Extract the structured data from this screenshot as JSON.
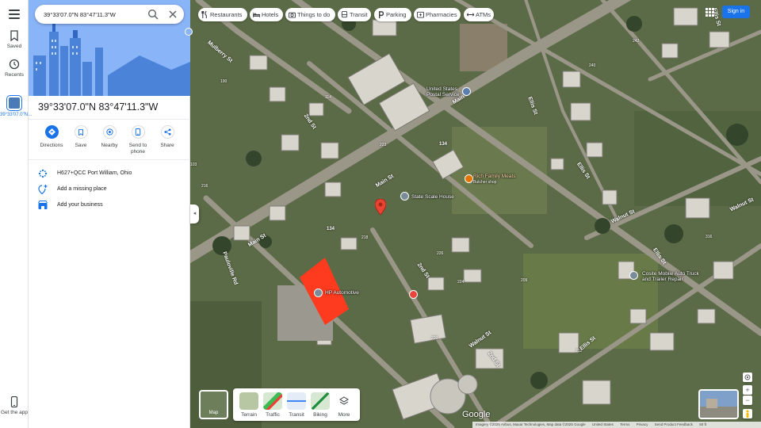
{
  "search": {
    "value": "39°33'07.0\"N 83°47'11.3\"W"
  },
  "rail": {
    "saved_label": "Saved",
    "recents_label": "Recents",
    "recent_place_label": "39°33'07.0\"N...",
    "get_app_label": "Get the app"
  },
  "place": {
    "title": "39°33'07.0\"N 83°47'11.3\"W",
    "actions": [
      {
        "label": "Directions",
        "icon": "directions-icon"
      },
      {
        "label": "Save",
        "icon": "bookmark-icon"
      },
      {
        "label": "Nearby",
        "icon": "nearby-icon"
      },
      {
        "label": "Send to phone",
        "icon": "phone-icon"
      },
      {
        "label": "Share",
        "icon": "share-icon"
      }
    ],
    "details": [
      {
        "text": "H627+QCC Port William, Ohio",
        "icon": "plus-code-icon"
      },
      {
        "text": "Add a missing place",
        "icon": "add-place-icon"
      },
      {
        "text": "Add your business",
        "icon": "business-icon"
      }
    ]
  },
  "chips": [
    {
      "label": "Restaurants",
      "icon": "restaurant-icon"
    },
    {
      "label": "Hotels",
      "icon": "hotel-icon"
    },
    {
      "label": "Things to do",
      "icon": "camera-icon"
    },
    {
      "label": "Transit",
      "icon": "transit-icon"
    },
    {
      "label": "Parking",
      "icon": "parking-icon"
    },
    {
      "label": "Pharmacies",
      "icon": "pharmacy-icon"
    },
    {
      "label": "ATMs",
      "icon": "atm-icon"
    }
  ],
  "header": {
    "signin_label": "Sign in"
  },
  "map": {
    "places": [
      {
        "name": "United States Postal Service"
      },
      {
        "name": "Rich Family Meats",
        "sub": "Butcher shop"
      },
      {
        "name": "State Scale House"
      },
      {
        "name": "HP Automotive"
      },
      {
        "name": "Cosite Mobile Auto Truck and Trailer Repair"
      }
    ],
    "roads": [
      "Mulberry St",
      "Main St",
      "2nd St",
      "Ellis St",
      "Walnut St",
      "Pauloville Rd",
      "134"
    ],
    "house_numbers": [
      "242",
      "240",
      "114",
      "223",
      "103",
      "218",
      "226",
      "224",
      "209",
      "220",
      "212",
      "316",
      "190",
      "216"
    ]
  },
  "layers": {
    "current": "Map",
    "options": [
      "Terrain",
      "Traffic",
      "Transit",
      "Biking",
      "More"
    ]
  },
  "branding": {
    "logo": "Google"
  },
  "attribution": {
    "imagery": "Imagery ©2025 Airbus, Maxar Technologies, Map data ©2025 Google",
    "country": "United States",
    "terms": "Terms",
    "privacy": "Privacy",
    "feedback": "Send Product Feedback",
    "scale": "50 ft"
  },
  "colors": {
    "accent": "#1a73e8",
    "highlight": "#ff3b1f",
    "pin": "#ea4335"
  }
}
